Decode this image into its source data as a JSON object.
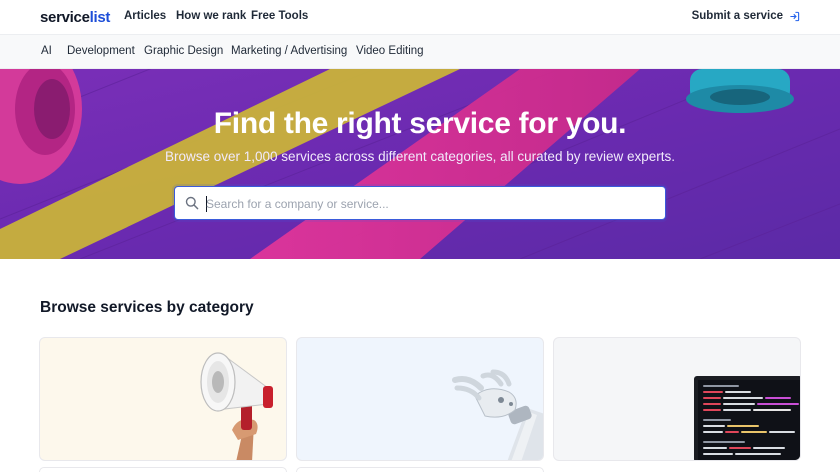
{
  "brand": {
    "logo_part1": "service",
    "logo_part2": "list",
    "accent": "#1d4ed8"
  },
  "topnav": {
    "links": [
      "Articles",
      "How we rank",
      "Free Tools"
    ],
    "submit_label": "Submit a service",
    "submit_icon": "sign-in-icon"
  },
  "categories": [
    "AI",
    "Development",
    "Graphic Design",
    "Marketing / Advertising",
    "Video Editing"
  ],
  "hero": {
    "title": "Find the right service for you.",
    "subtitle": "Browse over 1,000 services across different categories, all curated by review experts.",
    "search": {
      "placeholder": "Search for a company or service...",
      "value": "",
      "icon": "search-icon"
    }
  },
  "section": {
    "title": "Browse services by category"
  },
  "cards": [
    {
      "image": "megaphone-hand-image"
    },
    {
      "image": "robot-hand-image"
    },
    {
      "image": "code-laptop-image"
    }
  ]
}
